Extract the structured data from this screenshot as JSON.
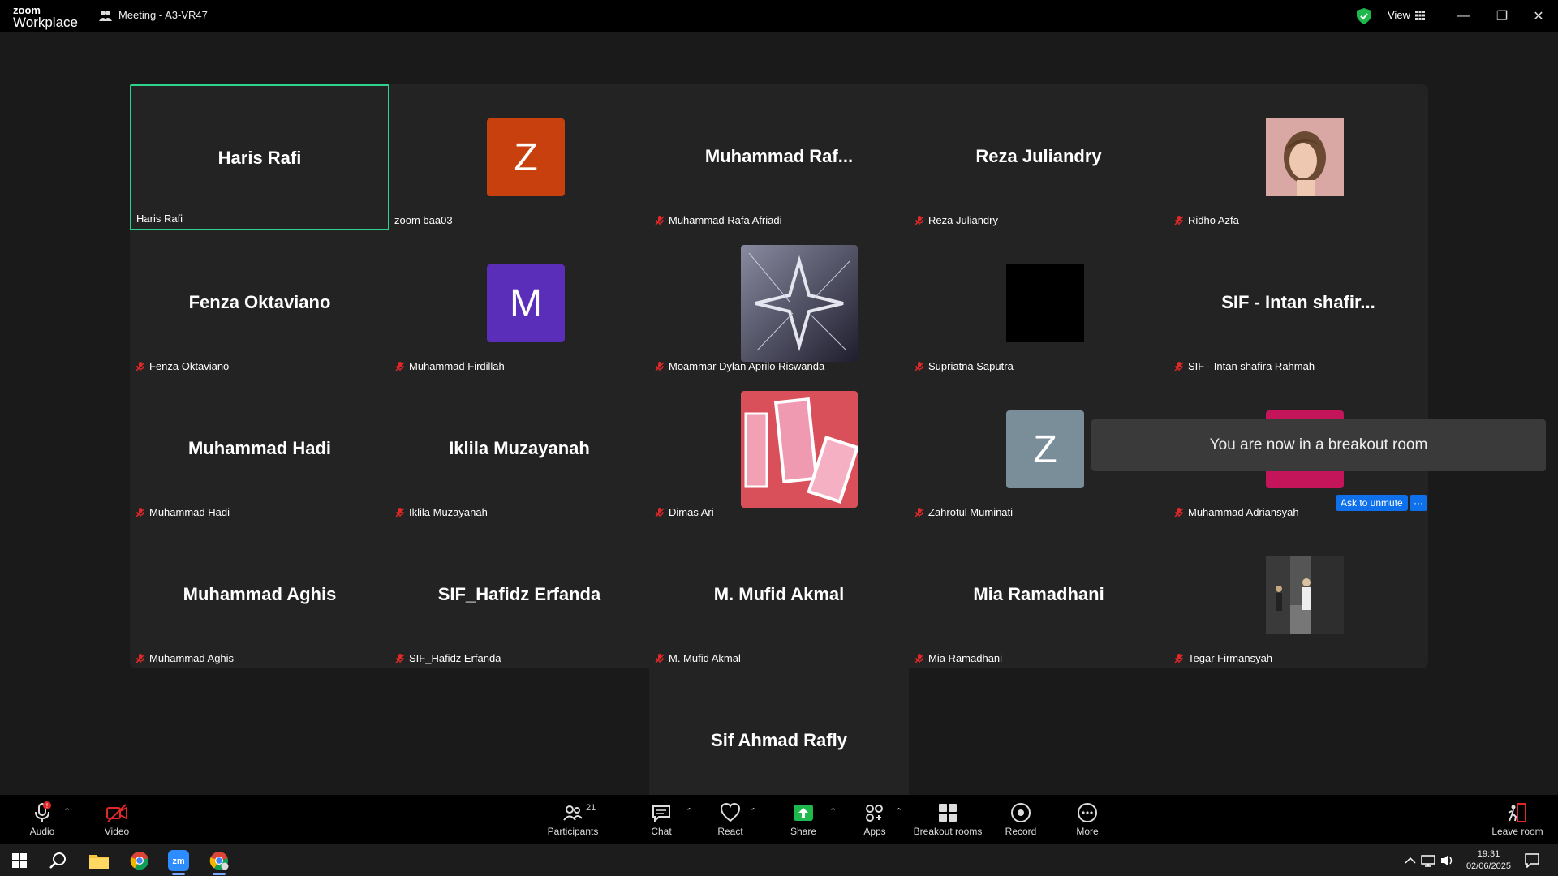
{
  "app": {
    "logo_line1": "zoom",
    "logo_line2": "Workplace",
    "meeting_title": "Meeting - A3-VR47",
    "view_label": "View"
  },
  "tiles": [
    {
      "big": "Haris Rafi",
      "label": "Haris Rafi",
      "muted": false
    },
    {
      "avatar_letter": "Z",
      "avatar_color": "#c8400e",
      "label": "zoom baa03",
      "muted": false
    },
    {
      "big": "Muhammad  Raf...",
      "label": "Muhammad Rafa Afriadi",
      "muted": true
    },
    {
      "big": "Reza Juliandry",
      "label": "Reza Juliandry",
      "muted": true
    },
    {
      "photo": "portrait",
      "label": "Ridho Azfa",
      "muted": true
    },
    {
      "big": "Fenza Oktaviano",
      "label": "Fenza Oktaviano",
      "muted": true
    },
    {
      "avatar_letter": "M",
      "avatar_color": "#5a2eb8",
      "label": "Muhammad Firdillah",
      "muted": true
    },
    {
      "photo": "star",
      "label": "Moammar Dylan Aprilo Riswanda",
      "muted": true
    },
    {
      "photo": "black",
      "label": "Supriatna Saputra",
      "muted": true
    },
    {
      "big": "SIF - Intan shafir...",
      "label": "SIF - Intan shafira Rahmah",
      "muted": true
    },
    {
      "big": "Muhammad Hadi",
      "label": "Muhammad Hadi",
      "muted": true
    },
    {
      "big": "Iklila Muzayanah",
      "label": "Iklila Muzayanah",
      "muted": true
    },
    {
      "photo": "cards",
      "label": "Dimas Ari",
      "muted": true
    },
    {
      "avatar_letter": "Z",
      "avatar_color": "#7a8e9a",
      "label": "Zahrotul Muminati",
      "muted": true
    },
    {
      "avatar_letter": "M",
      "avatar_color": "#c4155a",
      "label": "Muhammad Adriansyah",
      "muted": true
    },
    {
      "big": "Muhammad Aghis",
      "label": "Muhammad Aghis",
      "muted": true
    },
    {
      "big": "SIF_Hafidz Erfanda",
      "label": "SIF_Hafidz Erfanda",
      "muted": true
    },
    {
      "big": "M. Mufid Akmal",
      "label": "M. Mufid Akmal",
      "muted": true
    },
    {
      "big": "Mia Ramadhani",
      "label": "Mia Ramadhani",
      "muted": true
    },
    {
      "photo": "outdoor",
      "label": "Tegar Firmansyah",
      "muted": true
    },
    {
      "big": "Sif Ahmad Rafly",
      "label": "Sif Ahmad Rafly",
      "muted": true
    }
  ],
  "toast": {
    "text": "You are now in a breakout room"
  },
  "ask_unmute": {
    "label": "Ask to unmute",
    "more": "···"
  },
  "toolbar": {
    "audio": "Audio",
    "video": "Video",
    "participants": "Participants",
    "participants_count": "21",
    "chat": "Chat",
    "react": "React",
    "share": "Share",
    "apps": "Apps",
    "breakout": "Breakout rooms",
    "record": "Record",
    "more": "More",
    "leave": "Leave room"
  },
  "taskbar": {
    "time": "19:31",
    "date": "02/06/2025"
  }
}
